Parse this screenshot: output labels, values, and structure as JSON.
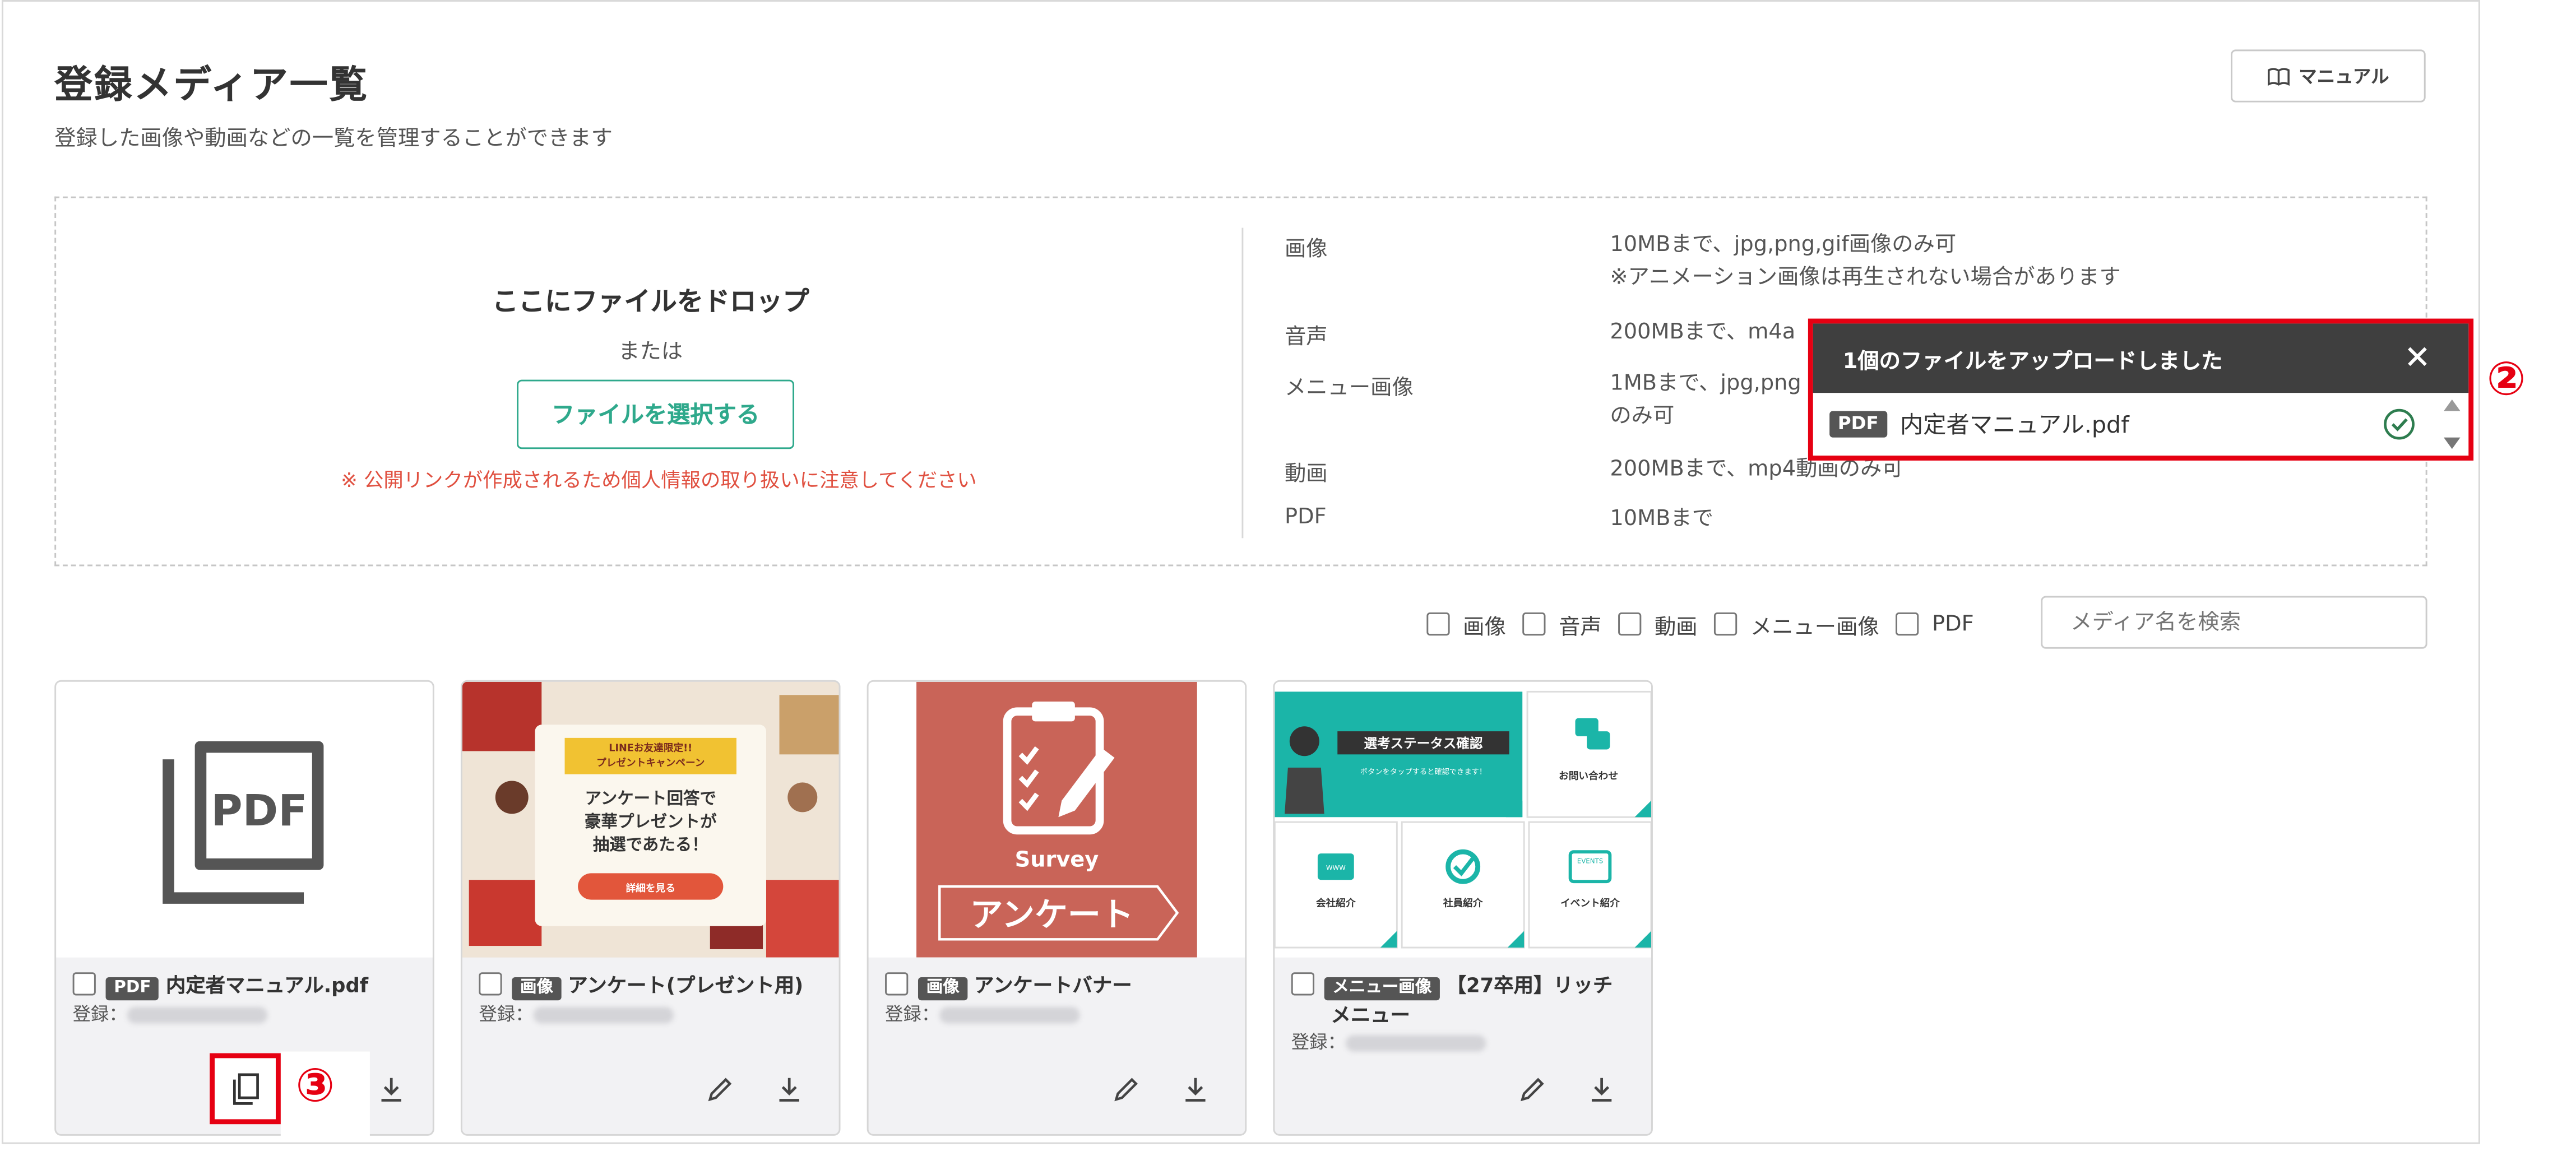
{
  "header": {
    "title": "登録メディア一覧",
    "subtitle": "登録した画像や動画などの一覧を管理することができます",
    "manual_label": "マニュアル",
    "manual_icon": "book-icon"
  },
  "dropzone": {
    "heading": "ここにファイルをドロップ",
    "or": "または",
    "select_button": "ファイルを選択する",
    "notice": "※ 公開リンクが作成されるため個人情報の取り扱いに注意してください",
    "specs": [
      {
        "label": "画像",
        "desc": "10MBまで、jpg,png,gif画像のみ可",
        "desc2": "※アニメーション画像は再生されない場合があります"
      },
      {
        "label": "音声",
        "desc": "200MBまで、m4a",
        "desc2": ""
      },
      {
        "label": "メニュー画像",
        "desc": "1MBまで、jpg,png",
        "desc2": "のみ可"
      },
      {
        "label": "動画",
        "desc": "200MBまで、mp4動画のみ可",
        "desc2": ""
      },
      {
        "label": "PDF",
        "desc": "10MBまで",
        "desc2": ""
      }
    ]
  },
  "filters": {
    "options": [
      "画像",
      "音声",
      "動画",
      "メニュー画像",
      "PDF"
    ],
    "search_placeholder": "メディア名を検索"
  },
  "media": [
    {
      "type": "PDF",
      "name": "内定者マニュアル.pdf",
      "registered_label": "登録：",
      "thumb_text": "PDF"
    },
    {
      "type": "画像",
      "name": "アンケート(プレゼント用)",
      "registered_label": "登録：",
      "thumb_line1": "LINEお友達限定!!",
      "thumb_line2": "プレゼントキャンペーン",
      "thumb_line3": "アンケート回答で",
      "thumb_line4": "豪華プレゼントが",
      "thumb_line5": "抽選であたる！",
      "thumb_button": "詳細を見る"
    },
    {
      "type": "画像",
      "name": "アンケートバナー",
      "registered_label": "登録：",
      "thumb_survey": "Survey",
      "thumb_title": "アンケート"
    },
    {
      "type": "メニュー画像",
      "name": "【27卒用】リッチ",
      "name2": "メニュー",
      "registered_label": "登録：",
      "tiles": {
        "status": "選考ステータス確認",
        "status_sub": "ボタンをタップすると確認できます！",
        "contact": "お問い合わせ",
        "company": "会社紹介",
        "staff": "社員紹介",
        "event": "イベント紹介",
        "www": "WWW",
        "events": "EVENTS"
      }
    }
  ],
  "toast": {
    "message": "1個のファイルをアップロードしました",
    "file_tag": "PDF",
    "file_name": "内定者マニュアル.pdf",
    "status_icon": "check-circle-icon"
  },
  "annotations": {
    "toast_number": "②",
    "copy_number": "③"
  },
  "colors": {
    "accent": "#2fa98c",
    "notice_red": "#e05040",
    "annotation_red": "#e60012",
    "teal": "#1bb5a8",
    "survey_bg": "#c96458"
  }
}
